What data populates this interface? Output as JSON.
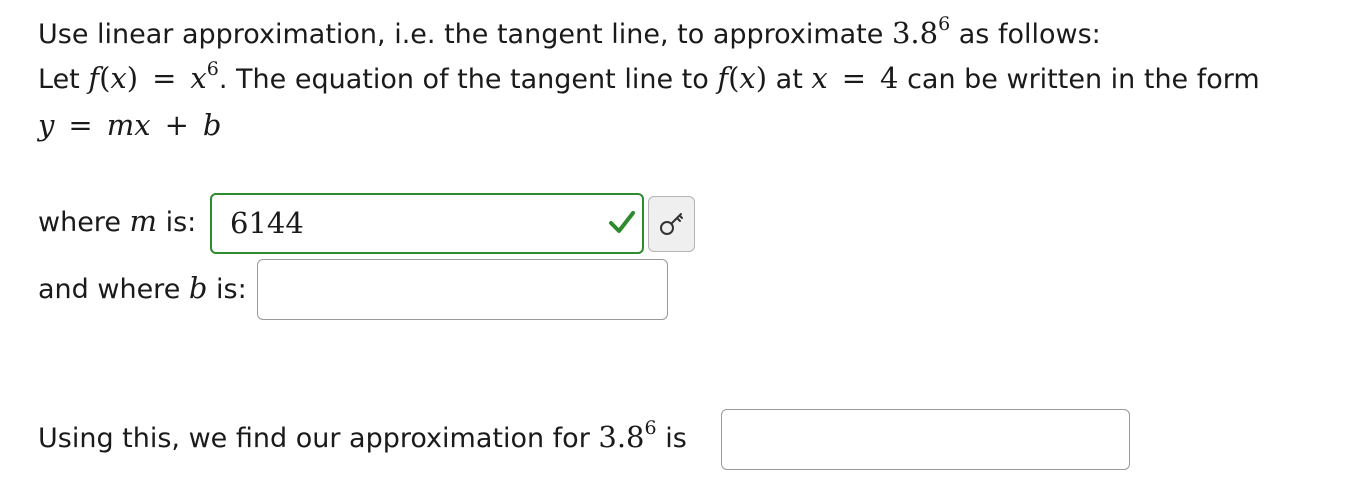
{
  "problem": {
    "intro_prefix": "Use linear approximation, i.e. the tangent line, to approximate ",
    "target_base": "3.8",
    "target_exp": "6",
    "intro_suffix": " as follows:",
    "let_word": "Let ",
    "f_name": "f",
    "open_paren": "(",
    "var_x": "x",
    "close_paren": ")",
    "equals": "=",
    "exponent": "6",
    "sentence_mid": ". The equation of the tangent line to ",
    "at_word": " at ",
    "x_value": "4",
    "sentence_end": " can be written in the form",
    "form_y": "y",
    "form_m": "m",
    "form_plus": "+",
    "form_b": "b"
  },
  "m_field": {
    "label_prefix": "where ",
    "label_var": "m",
    "label_suffix": " is:",
    "value": "6144",
    "status": "correct",
    "status_icon": "check-icon",
    "status_color": "#2e8b2e"
  },
  "b_field": {
    "label_prefix": "and where ",
    "label_var": "b",
    "label_suffix": " is:",
    "value": ""
  },
  "approx_field": {
    "label_prefix": "Using this, we find our approximation for ",
    "label_base": "3.8",
    "label_exp": "6",
    "label_suffix": " is",
    "value": ""
  },
  "key_button": {
    "icon": "key-icon"
  }
}
